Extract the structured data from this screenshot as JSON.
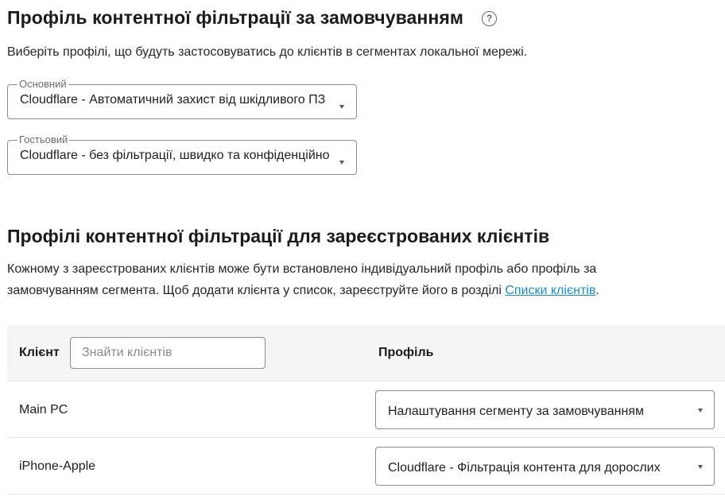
{
  "default_section": {
    "title": "Профіль контентної фільтрації за замовчуванням",
    "description": "Виберіть профілі, що будуть застосовуватись до клієнтів в сегментах локальної мережі.",
    "main_select": {
      "label": "Основний",
      "value": "Cloudflare - Автоматичний захист від шкідливого ПЗ"
    },
    "guest_select": {
      "label": "Гостьовий",
      "value": "Cloudflare - без фільтрації, швидко та конфіденційно"
    }
  },
  "clients_section": {
    "title": "Профілі контентної фільтрації для зареєстрованих клієнтів",
    "description_part1": "Кожному з зареєстрованих клієнтів може бути встановлено індивідуальний профіль або профіль за",
    "description_part2": "замовчуванням сегмента. Щоб додати клієнта у список, зареєструйте його в розділі ",
    "link_text": "Списки клієнтів",
    "description_end": "."
  },
  "table": {
    "col_client": "Клієнт",
    "search_placeholder": "Знайти клієнтів",
    "col_profile": "Профіль",
    "rows": [
      {
        "client": "Main PC",
        "profile": "Налаштування сегменту за замовчуванням"
      },
      {
        "client": "iPhone-Apple",
        "profile": "Cloudflare - Фільтрація контента для дорослих"
      }
    ]
  }
}
